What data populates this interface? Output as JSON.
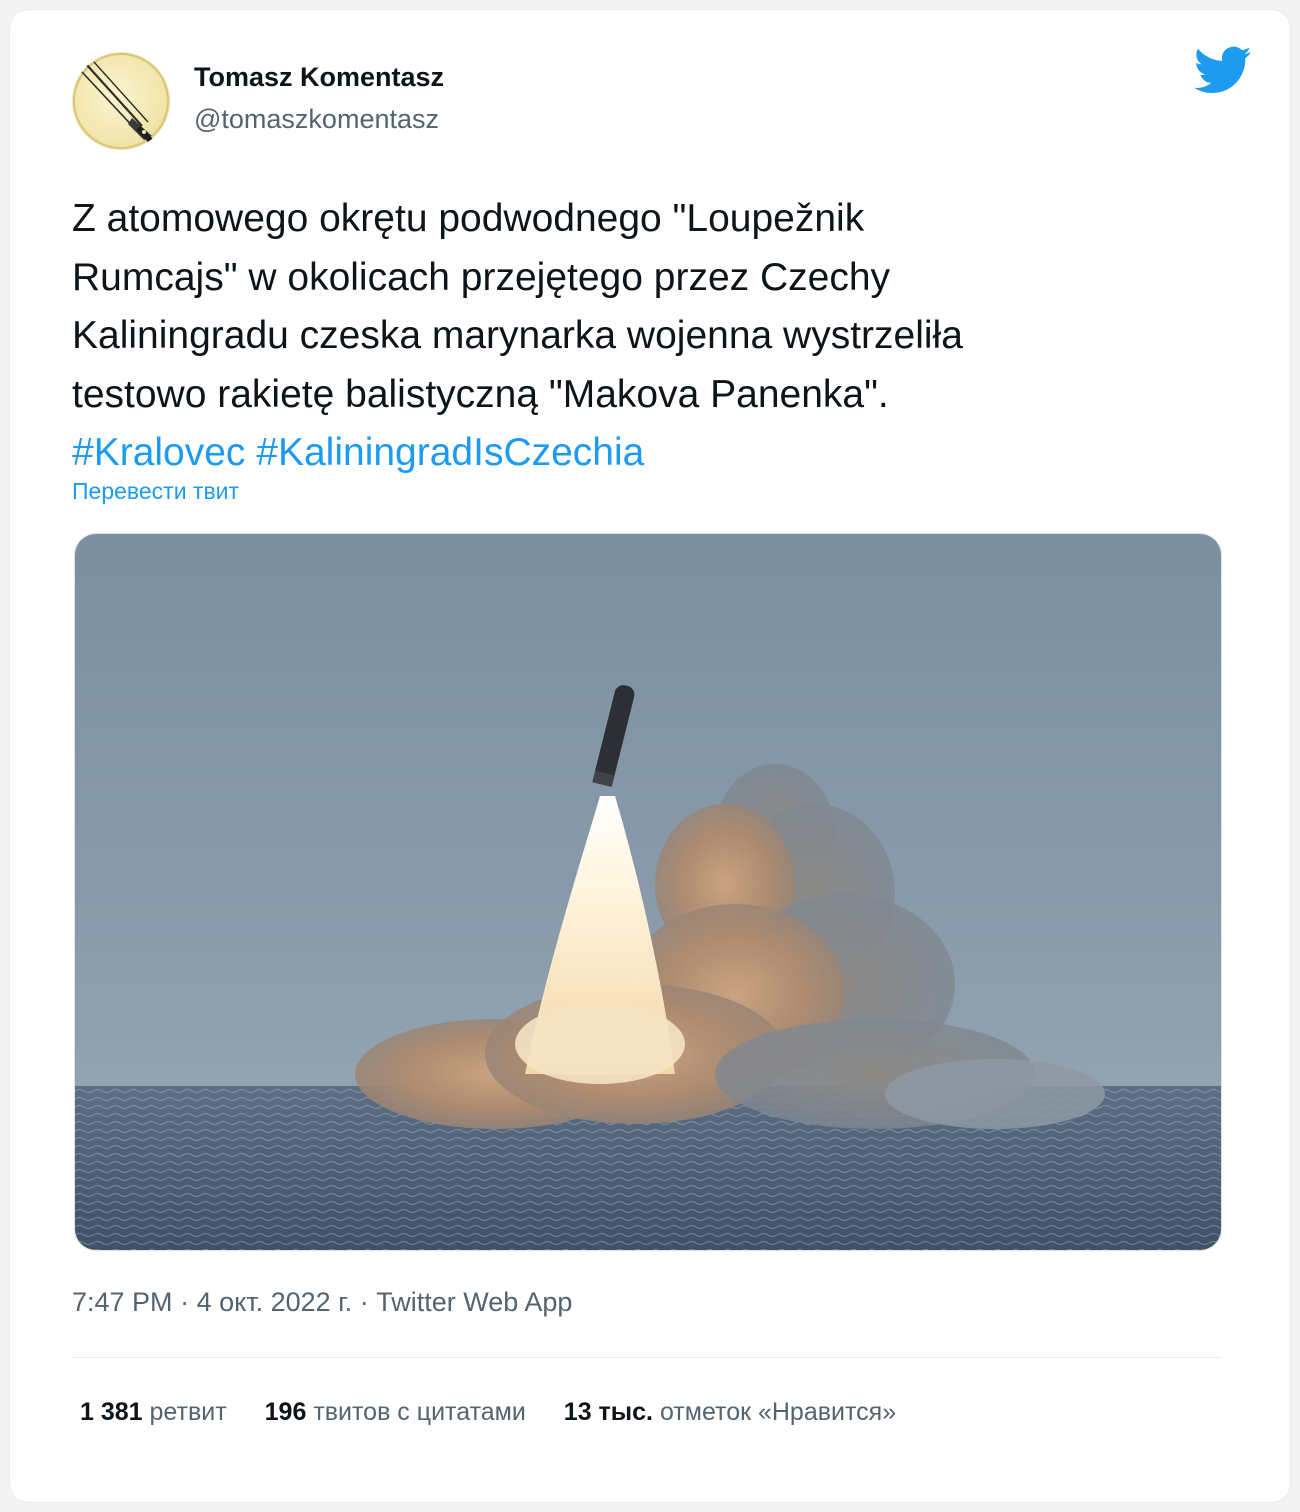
{
  "author": {
    "name": "Tomasz Komentasz",
    "handle": "@tomaszkomentasz",
    "avatar_icon": "fountain-pen-nib-icon"
  },
  "brand": {
    "icon": "twitter-bird-icon",
    "color": "#1d9bf0"
  },
  "tweet": {
    "text_lines": [
      "Z atomowego okrętu podwodnego \"Loupežnik",
      "Rumcajs\" w okolicach przejętego przez Czechy",
      "Kaliningradu czeska marynarka wojenna wystrzeliła",
      "testowo rakietę balistyczną \"Makova Panenka\"."
    ],
    "hashtags": [
      "#Kralovec",
      "#KaliningradIsCzechia"
    ],
    "translate_label": "Перевести твит"
  },
  "media": {
    "type": "photo",
    "icon": "missile-launch-photo"
  },
  "meta": {
    "time": "7:47 PM",
    "separator": "·",
    "date": "4 окт. 2022 г.",
    "source": "Twitter Web App"
  },
  "stats": {
    "retweets_count": "1 381",
    "retweets_label": "ретвит",
    "quotes_count": "196",
    "quotes_label": "твитов с цитатами",
    "likes_count": "13 тыс.",
    "likes_label": "отметок «Нравится»"
  }
}
